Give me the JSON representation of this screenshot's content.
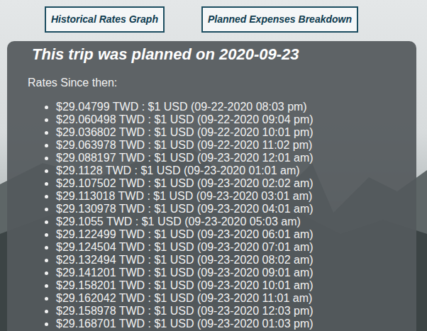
{
  "buttons": [
    "Historical Rates Graph",
    "Planned Expenses Breakdown"
  ],
  "card": {
    "title": "This trip was planned on 2020-09-23",
    "label": "Rates Since then:"
  },
  "rates": [
    "$29.04799 TWD : $1 USD (09-22-2020 08:03 pm)",
    "$29.060498 TWD : $1 USD (09-22-2020 09:04 pm)",
    "$29.036802 TWD : $1 USD (09-22-2020 10:01 pm)",
    "$29.063978 TWD : $1 USD (09-22-2020 11:02 pm)",
    "$29.088197 TWD : $1 USD (09-23-2020 12:01 am)",
    "$29.1128 TWD : $1 USD (09-23-2020 01:01 am)",
    "$29.107502 TWD : $1 USD (09-23-2020 02:02 am)",
    "$29.113018 TWD : $1 USD (09-23-2020 03:01 am)",
    "$29.130978 TWD : $1 USD (09-23-2020 04:01 am)",
    "$29.1055 TWD : $1 USD (09-23-2020 05:03 am)",
    "$29.122499 TWD : $1 USD (09-23-2020 06:01 am)",
    "$29.124504 TWD : $1 USD (09-23-2020 07:01 am)",
    "$29.132494 TWD : $1 USD (09-23-2020 08:02 am)",
    "$29.141201 TWD : $1 USD (09-23-2020 09:01 am)",
    "$29.158201 TWD : $1 USD (09-23-2020 10:01 am)",
    "$29.162042 TWD : $1 USD (09-23-2020 11:01 am)",
    "$29.158978 TWD : $1 USD (09-23-2020 12:03 pm)",
    "$29.168701 TWD : $1 USD (09-23-2020 01:03 pm)"
  ]
}
